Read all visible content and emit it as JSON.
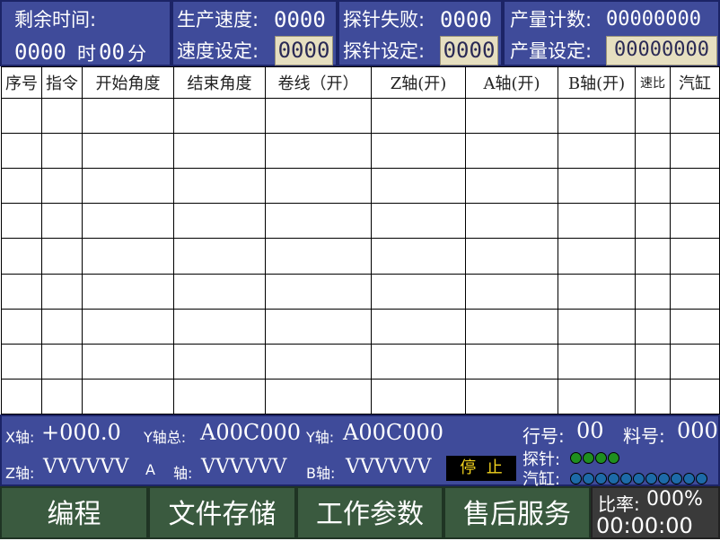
{
  "header": {
    "remaining_time_label": "剩余时间:",
    "remaining_time_value": "0000",
    "remaining_time_hour_unit": "时",
    "remaining_time_minute_value": "00",
    "remaining_time_minute_unit": "分",
    "production_speed_label": "生产速度:",
    "production_speed_value": "0000",
    "speed_setting_label": "速度设定:",
    "speed_setting_value": "0000",
    "probe_fail_label": "探针失败:",
    "probe_fail_value": "0000",
    "probe_setting_label": "探针设定:",
    "probe_setting_value": "0000",
    "output_count_label": "产量计数:",
    "output_count_value": "00000000",
    "output_setting_label": "产量设定:",
    "output_setting_value": "00000000"
  },
  "table": {
    "columns": [
      "序号",
      "指令",
      "开始角度",
      "结束角度",
      "卷线（开）",
      "Z轴(开)",
      "A轴(开)",
      "B轴(开)",
      "速比",
      "汽缸"
    ]
  },
  "status": {
    "x_axis_label": "X轴:",
    "x_axis_value": "+000.0",
    "y_total_label": "Y轴总:",
    "y_total_value": "A00C000",
    "y_axis_label": "Y轴:",
    "y_axis_value": "A00C000",
    "z_axis_label": "Z轴:",
    "z_axis_value": "VVVVVV",
    "a_axis_label_a": "A",
    "a_axis_label_b": "轴:",
    "a_axis_value": "VVVVVV",
    "b_axis_label": "B轴:",
    "b_axis_value": "VVVVVV",
    "run_state": "停  止",
    "row_no_label": "行号:",
    "row_no_value": "00",
    "material_no_label": "料号:",
    "material_no_value": "000",
    "probe_label": "探针:",
    "probe_lights": 4,
    "cylinder_label": "汽缸:",
    "cylinder_lights": 12,
    "probe_light_color": "#1f8f1f",
    "cylinder_light_color": "#1d6aa8"
  },
  "nav": {
    "btn1": "编程",
    "btn2": "文件存储",
    "btn3": "工作参数",
    "btn4": "售后服务",
    "ratio_label": "比率:",
    "ratio_value": "000%",
    "clock": "00:00:00"
  },
  "colors": {
    "panel_blue": "#3f4b9a",
    "nav_green": "#3a5a3f",
    "input_bg": "#e6dfc0",
    "run_state_bg": "#000000",
    "run_state_fg": "#f2d21e"
  }
}
